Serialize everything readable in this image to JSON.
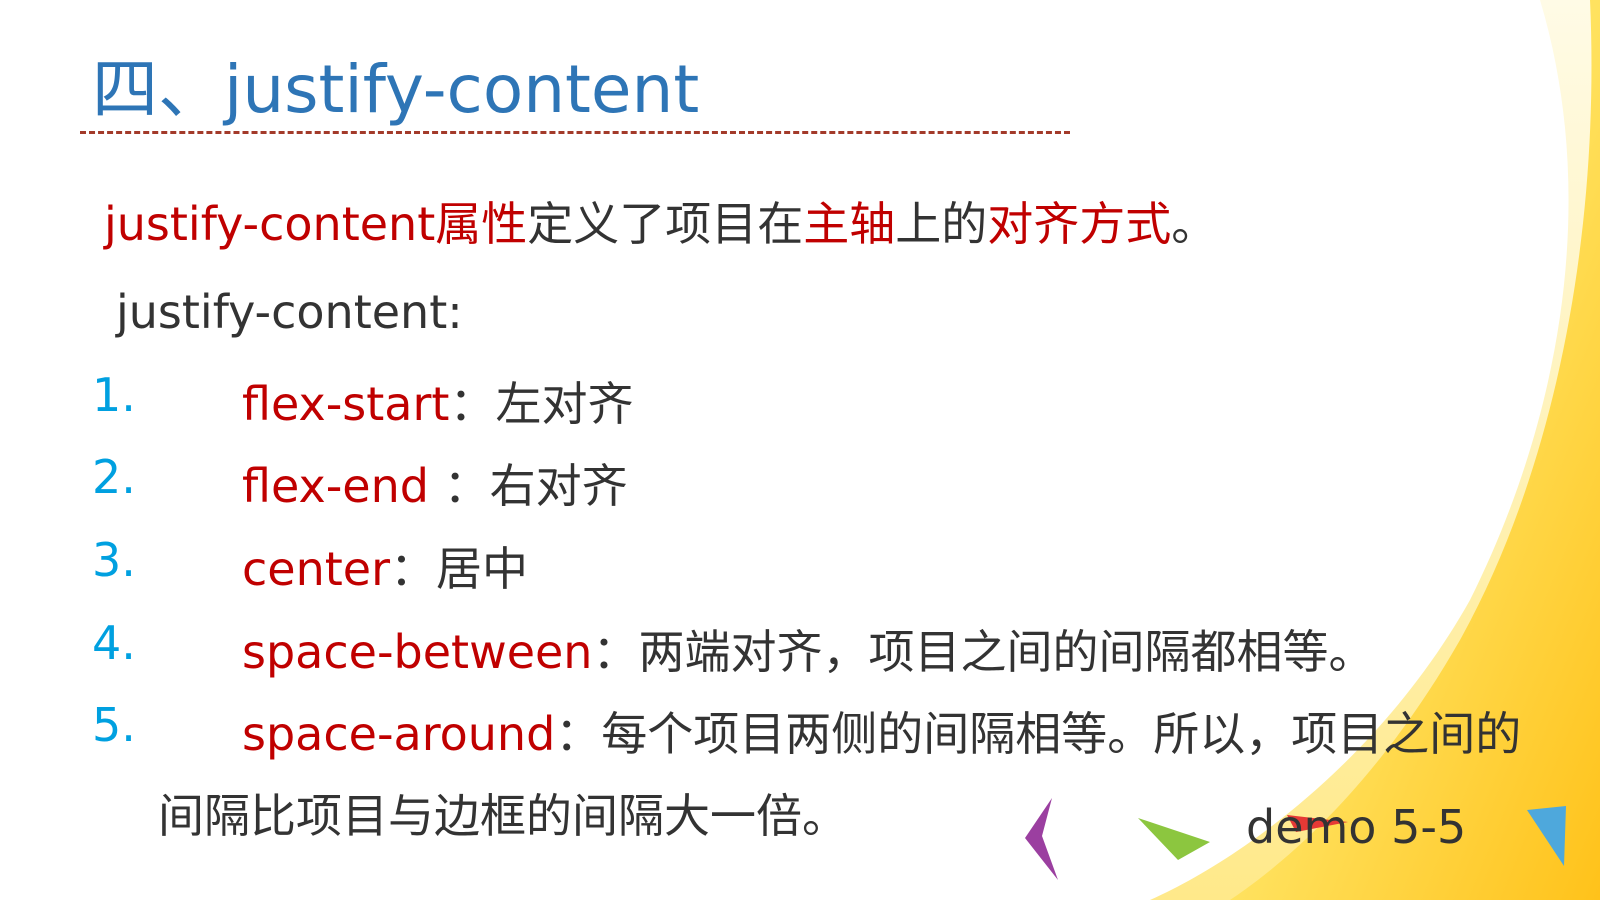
{
  "slide": {
    "title": "四、justify-content",
    "intro": {
      "segments": [
        {
          "text": "justify-content属性",
          "red": true
        },
        {
          "text": "定义了项目在",
          "red": false
        },
        {
          "text": "主轴",
          "red": true
        },
        {
          "text": "上的",
          "red": false
        },
        {
          "text": "对齐方式",
          "red": true
        },
        {
          "text": "。",
          "red": false
        }
      ]
    },
    "subheading": "justify-content:",
    "items": [
      {
        "number": "1.",
        "keyword": "flex-start",
        "desc": "：左对齐"
      },
      {
        "number": "2.",
        "keyword": "flex-end",
        "desc": " ：右对齐"
      },
      {
        "number": "3.",
        "keyword": "center",
        "desc": "：居中"
      },
      {
        "number": "4.",
        "keyword": "space-between",
        "desc": "：两端对齐，项目之间的间隔都相等。"
      },
      {
        "number": "5.",
        "keyword": "space-around",
        "desc": "：每个项目两侧的间隔相等。所以，项目之间的"
      }
    ],
    "item5_continuation": "间隔比项目与边框的间隔大一倍。",
    "demo_label": "demo 5-5"
  },
  "colors": {
    "title": "#2e75b6",
    "accent_red": "#c00000",
    "number_blue": "#00a0e0",
    "body_text": "#333333",
    "rule": "#a33a2a",
    "swoosh_yellow": "#ffd84a"
  }
}
